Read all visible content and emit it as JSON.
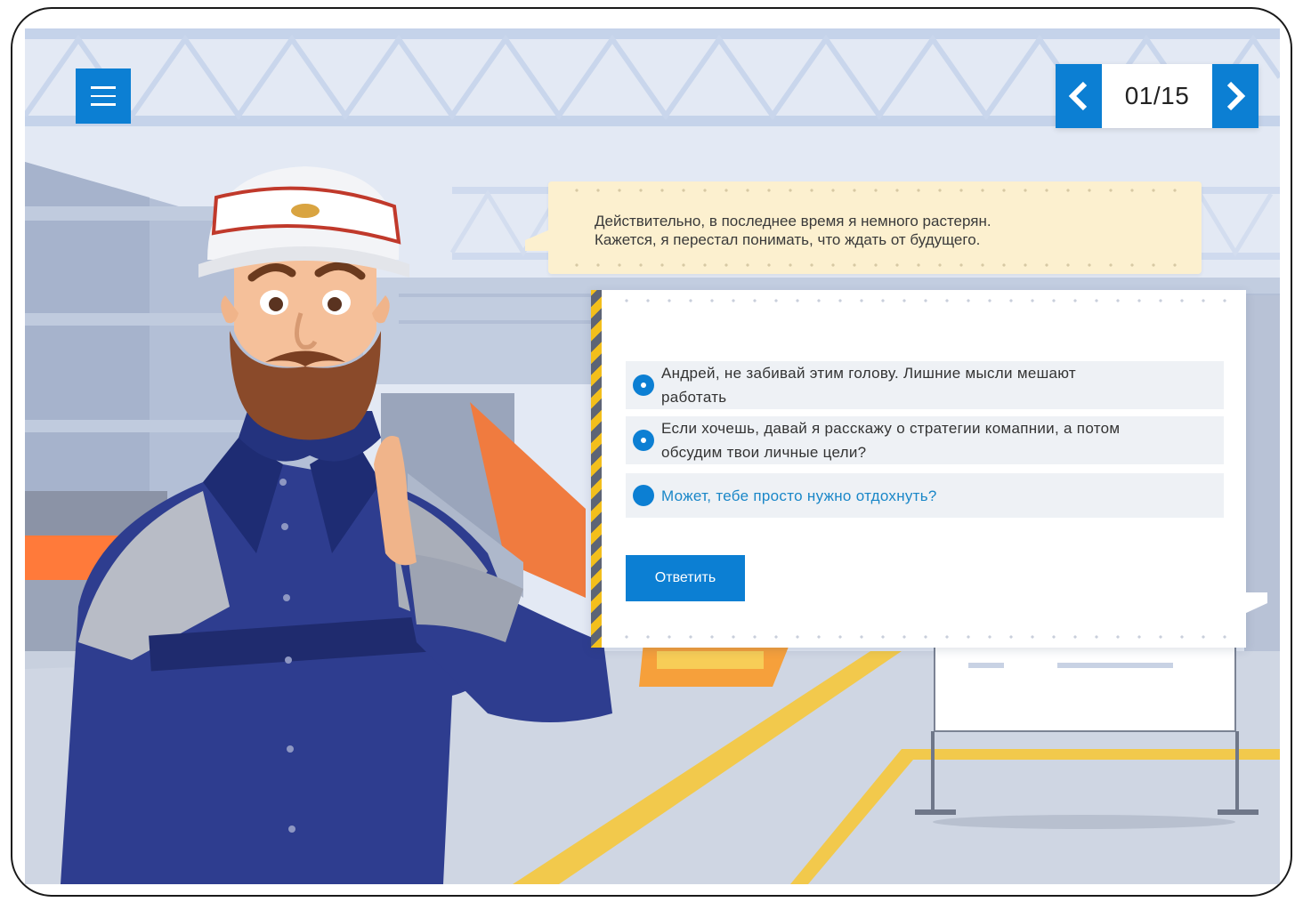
{
  "header": {
    "menu_icon": "hamburger-menu-icon",
    "progress": {
      "text": "01/15",
      "current": 1,
      "total": 15
    },
    "prev_icon": "chevron-left-icon",
    "next_icon": "chevron-right-icon"
  },
  "character": {
    "icon": "worker-character-illustration"
  },
  "speech": {
    "line1": "Действительно, в последнее время я немного растерян.",
    "line2": "Кажется, я перестал понимать, что ждать от будущего."
  },
  "options": [
    {
      "line1": "Андрей, не забивай этим голову. Лишние мысли мешают",
      "line2": "работать",
      "selected": false
    },
    {
      "line1": "Если хочешь, давай я расскажу о стратегии комапнии, а потом",
      "line2": "обсудим твои личные цели?",
      "selected": false
    },
    {
      "line1": "Может, тебе просто нужно отдохнуть?",
      "selected": true
    }
  ],
  "answer_button": {
    "label": "Ответить"
  },
  "colors": {
    "accent": "#0c7fd3",
    "speech_bg": "#fcf0cf",
    "selected_text": "#1a87c8",
    "option_bg": "#eef1f5"
  }
}
